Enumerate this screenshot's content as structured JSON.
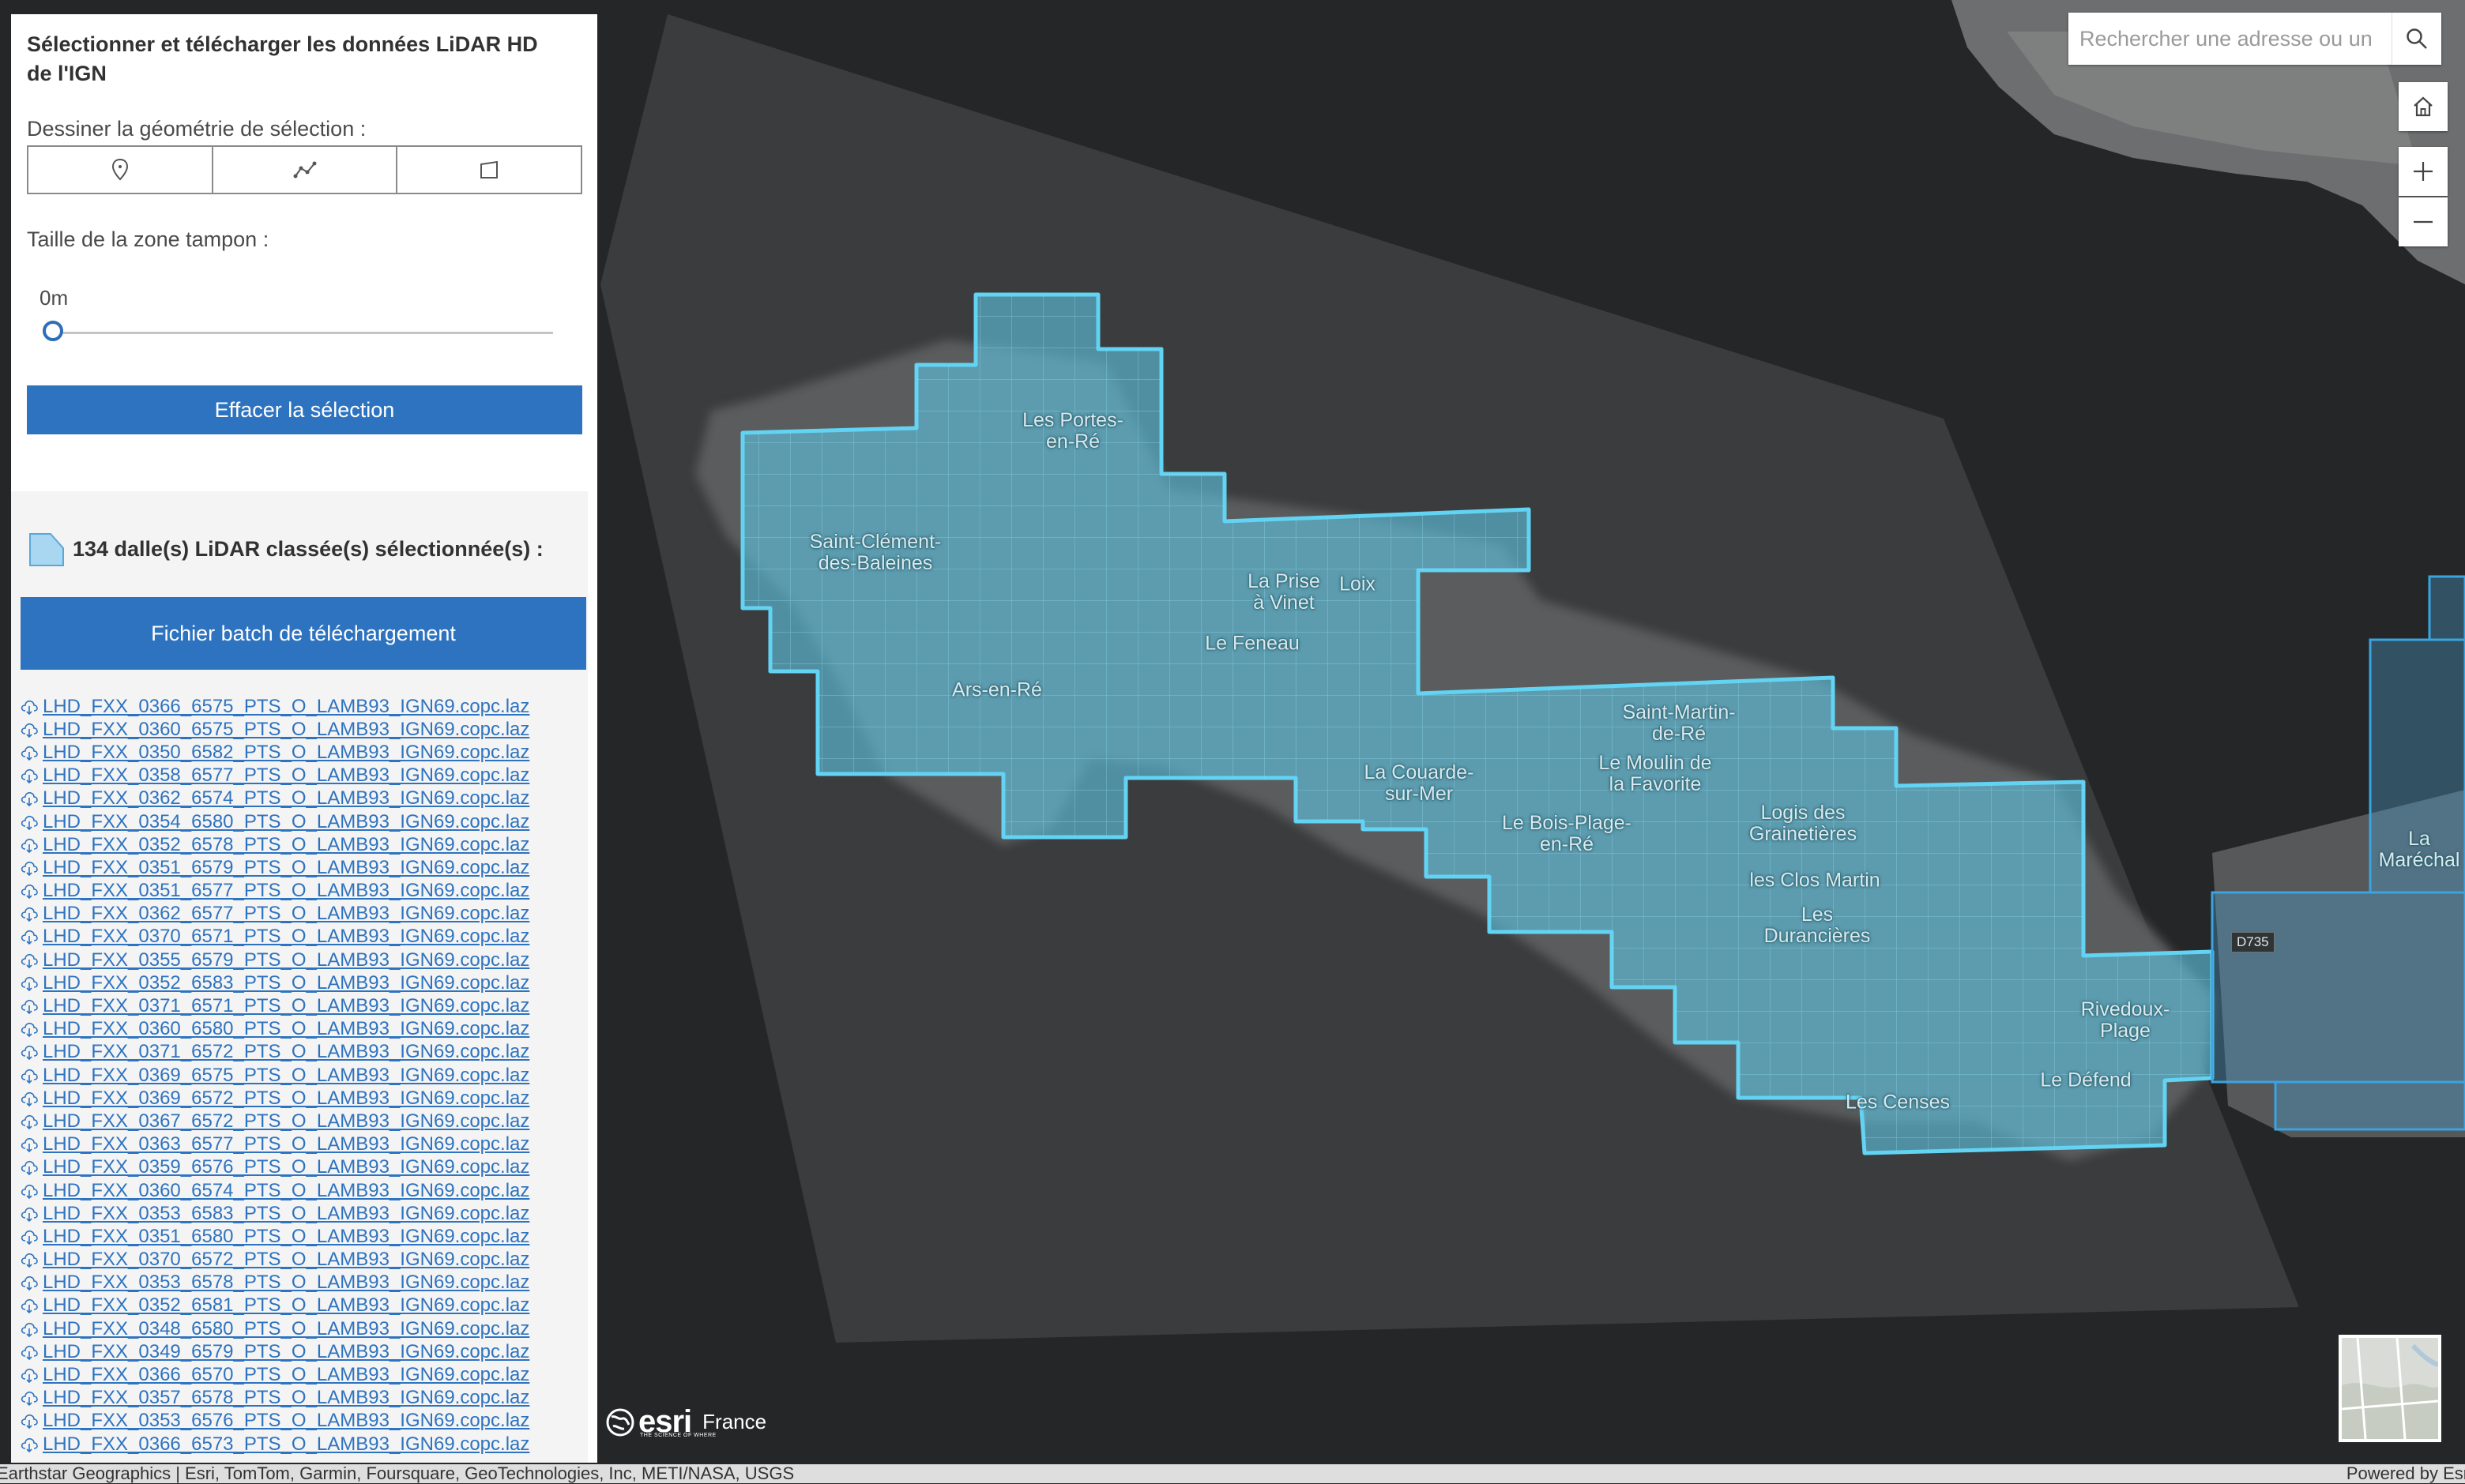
{
  "panel": {
    "title": "Sélectionner et télécharger les données LiDAR HD de l'IGN",
    "draw_label": "Dessiner la géométrie de sélection :",
    "draw_tools": [
      {
        "name": "point",
        "icon": "point-tool-icon"
      },
      {
        "name": "polyline",
        "icon": "polyline-tool-icon"
      },
      {
        "name": "polygon",
        "icon": "polygon-tool-icon"
      }
    ],
    "buffer_label": "Taille de la zone tampon :",
    "buffer_value": "0m",
    "buffer_slider_fraction": 0,
    "clear_button": "Effacer la sélection",
    "results_count": "134 dalle(s) LiDAR classée(s) sélectionnée(s) :",
    "results_icon": "tile-selection-icon",
    "batch_button": "Fichier batch de téléchargement",
    "files": [
      "LHD_FXX_0366_6575_PTS_O_LAMB93_IGN69.copc.laz",
      "LHD_FXX_0360_6575_PTS_O_LAMB93_IGN69.copc.laz",
      "LHD_FXX_0350_6582_PTS_O_LAMB93_IGN69.copc.laz",
      "LHD_FXX_0358_6577_PTS_O_LAMB93_IGN69.copc.laz",
      "LHD_FXX_0362_6574_PTS_O_LAMB93_IGN69.copc.laz",
      "LHD_FXX_0354_6580_PTS_O_LAMB93_IGN69.copc.laz",
      "LHD_FXX_0352_6578_PTS_O_LAMB93_IGN69.copc.laz",
      "LHD_FXX_0351_6579_PTS_O_LAMB93_IGN69.copc.laz",
      "LHD_FXX_0351_6577_PTS_O_LAMB93_IGN69.copc.laz",
      "LHD_FXX_0362_6577_PTS_O_LAMB93_IGN69.copc.laz",
      "LHD_FXX_0370_6571_PTS_O_LAMB93_IGN69.copc.laz",
      "LHD_FXX_0355_6579_PTS_O_LAMB93_IGN69.copc.laz",
      "LHD_FXX_0352_6583_PTS_O_LAMB93_IGN69.copc.laz",
      "LHD_FXX_0371_6571_PTS_O_LAMB93_IGN69.copc.laz",
      "LHD_FXX_0360_6580_PTS_O_LAMB93_IGN69.copc.laz",
      "LHD_FXX_0371_6572_PTS_O_LAMB93_IGN69.copc.laz",
      "LHD_FXX_0369_6575_PTS_O_LAMB93_IGN69.copc.laz",
      "LHD_FXX_0369_6572_PTS_O_LAMB93_IGN69.copc.laz",
      "LHD_FXX_0367_6572_PTS_O_LAMB93_IGN69.copc.laz",
      "LHD_FXX_0363_6577_PTS_O_LAMB93_IGN69.copc.laz",
      "LHD_FXX_0359_6576_PTS_O_LAMB93_IGN69.copc.laz",
      "LHD_FXX_0360_6574_PTS_O_LAMB93_IGN69.copc.laz",
      "LHD_FXX_0353_6583_PTS_O_LAMB93_IGN69.copc.laz",
      "LHD_FXX_0351_6580_PTS_O_LAMB93_IGN69.copc.laz",
      "LHD_FXX_0370_6572_PTS_O_LAMB93_IGN69.copc.laz",
      "LHD_FXX_0353_6578_PTS_O_LAMB93_IGN69.copc.laz",
      "LHD_FXX_0352_6581_PTS_O_LAMB93_IGN69.copc.laz",
      "LHD_FXX_0348_6580_PTS_O_LAMB93_IGN69.copc.laz",
      "LHD_FXX_0349_6579_PTS_O_LAMB93_IGN69.copc.laz",
      "LHD_FXX_0366_6570_PTS_O_LAMB93_IGN69.copc.laz",
      "LHD_FXX_0357_6578_PTS_O_LAMB93_IGN69.copc.laz",
      "LHD_FXX_0353_6576_PTS_O_LAMB93_IGN69.copc.laz",
      "LHD_FXX_0366_6573_PTS_O_LAMB93_IGN69.copc.laz"
    ],
    "file_icon": "cloud-download-icon"
  },
  "search": {
    "placeholder": "Rechercher une adresse ou un",
    "button_icon": "search-icon"
  },
  "map_controls": {
    "home_icon": "home-icon",
    "zoom_in_icon": "plus-icon",
    "zoom_out_icon": "minus-icon",
    "basemap_icon": "basemap-thumbnail"
  },
  "map": {
    "place_labels": [
      "Les Portes-\nen-Ré",
      "Saint-Clément-\ndes-Baleines",
      "La Prise\nà Vinet",
      "Loix",
      "Le Feneau",
      "Ars-en-Ré",
      "Saint-Martin-\nde-Ré",
      "Le Moulin de\nla Favorite",
      "La Couarde-\nsur-Mer",
      "Le Bois-Plage-\nen-Ré",
      "Logis des\nGrainetières",
      "les Clos Martin",
      "Les\nDurancières",
      "Rivedoux-\nPlage",
      "Le Défend",
      "Les Censes",
      "La Maréchal"
    ],
    "road_badge": "D735",
    "colors": {
      "selection_fill": "#5ec4e0",
      "selection_stroke": "#62d3f3",
      "tile_grid": "#7fd6ee",
      "other_tiles_stroke": "#3aa4e0"
    }
  },
  "branding": {
    "logo_word": "esri",
    "logo_tagline": "THE SCIENCE OF WHERE",
    "country": "France"
  },
  "attribution": {
    "left": "Earthstar Geographics | Esri, TomTom, Garmin, Foursquare, GeoTechnologies, Inc, METI/NASA, USGS",
    "right": "Powered by Esri"
  }
}
